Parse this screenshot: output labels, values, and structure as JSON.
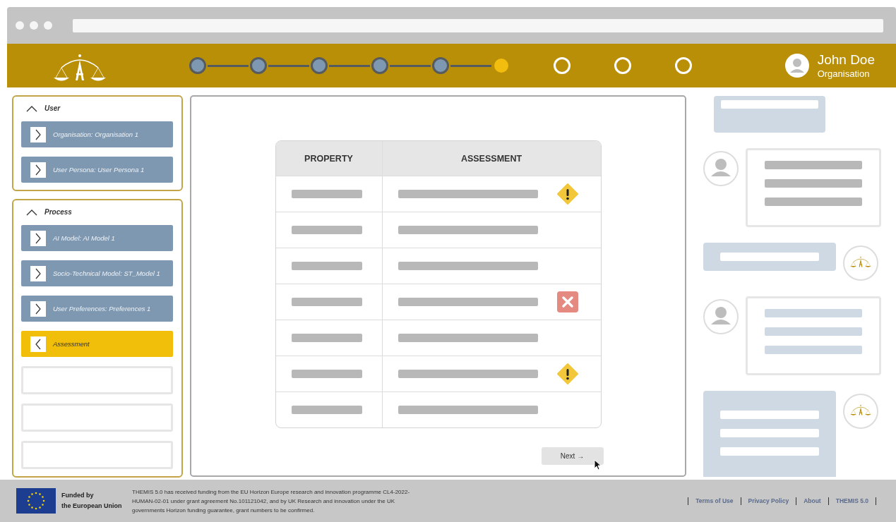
{
  "header": {
    "user": {
      "name": "John Doe",
      "role": "Organisation"
    },
    "steps": [
      {
        "completed": true,
        "current": false
      },
      {
        "completed": true,
        "current": false
      },
      {
        "completed": true,
        "current": false
      },
      {
        "completed": true,
        "current": false
      },
      {
        "completed": true,
        "current": false
      },
      {
        "completed": false,
        "current": true
      },
      {
        "completed": false,
        "current": false
      },
      {
        "completed": false,
        "current": false
      },
      {
        "completed": false,
        "current": false
      }
    ]
  },
  "sidebar": {
    "sections": [
      {
        "title": "User",
        "expanded": true,
        "items": [
          {
            "kind": "entry",
            "label": "Organisation: Organisation 1",
            "selected": false
          },
          {
            "kind": "entry",
            "label": "User Persona: User Persona 1",
            "selected": false
          }
        ]
      },
      {
        "title": "Process",
        "expanded": true,
        "items": [
          {
            "kind": "entry",
            "label": "AI Model: AI Model 1",
            "selected": false
          },
          {
            "kind": "entry",
            "label": "Socio-Technical Model: ST_Model 1",
            "selected": false
          },
          {
            "kind": "entry",
            "label": "User Preferences: Preferences 1",
            "selected": false
          },
          {
            "kind": "entry",
            "label": "Assessment",
            "selected": true
          },
          {
            "kind": "empty"
          },
          {
            "kind": "empty"
          },
          {
            "kind": "empty"
          }
        ]
      }
    ]
  },
  "table": {
    "columns": [
      "PROPERTY",
      "ASSESSMENT"
    ],
    "rows": [
      {
        "warning": true,
        "error": false
      },
      {
        "warning": false,
        "error": false
      },
      {
        "warning": false,
        "error": false
      },
      {
        "warning": false,
        "error": true
      },
      {
        "warning": false,
        "error": false
      },
      {
        "warning": true,
        "error": false
      },
      {
        "warning": false,
        "error": false
      }
    ]
  },
  "next_button": {
    "label": "Next →"
  },
  "chat": {
    "messages": [
      {
        "kind": "bot",
        "long": false,
        "avatar": false
      },
      {
        "kind": "user",
        "long": true,
        "avatar": true,
        "tinted": false
      },
      {
        "kind": "bot",
        "long": false,
        "avatar": true
      },
      {
        "kind": "user",
        "long": true,
        "avatar": true,
        "tinted": true
      },
      {
        "kind": "bot",
        "long": true,
        "avatar": true
      }
    ]
  },
  "footer": {
    "funded_by": "Funded by",
    "funder": "the European Union",
    "notice": "THEMIS 5.0 has received funding from  the EU Horizon Europe research and innovation programme CL4-2022-HUMAN-02-01 under grant agreement No.101121042, and by UK  Research and innovation under the UK governments Horizon funding  guarantee, grant numbers to be confirmed.",
    "links": [
      "Terms of Use",
      "Privacy Policy",
      "About",
      "THEMIS 5.0"
    ]
  }
}
